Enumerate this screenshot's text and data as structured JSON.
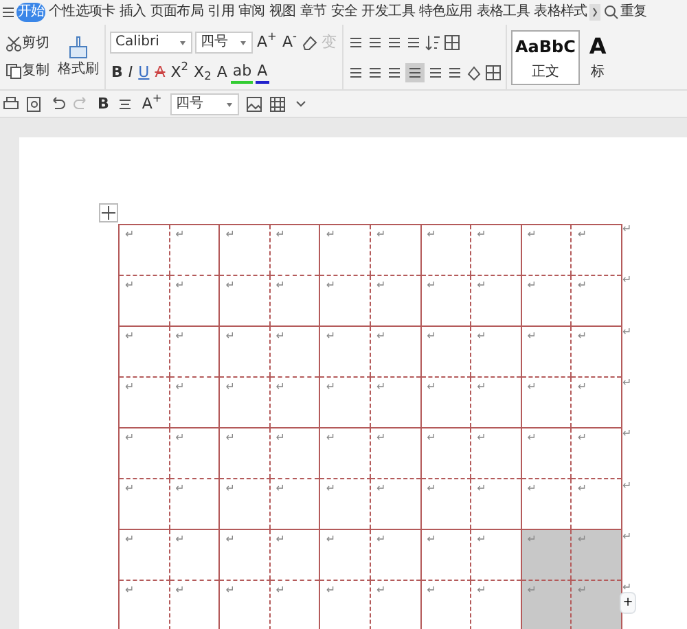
{
  "menu_tabs": [
    {
      "label": "开始",
      "selected": true
    },
    {
      "label": "个性选项卡",
      "selected": false
    },
    {
      "label": "插入",
      "selected": false
    },
    {
      "label": "页面布局",
      "selected": false
    },
    {
      "label": "引用",
      "selected": false
    },
    {
      "label": "审阅",
      "selected": false
    },
    {
      "label": "视图",
      "selected": false
    },
    {
      "label": "章节",
      "selected": false
    },
    {
      "label": "安全",
      "selected": false
    },
    {
      "label": "开发工具",
      "selected": false
    },
    {
      "label": "特色应用",
      "selected": false
    },
    {
      "label": "表格工具",
      "selected": false
    },
    {
      "label": "表格样式",
      "selected": false
    }
  ],
  "search": {
    "label": "重复"
  },
  "clipboard": {
    "cut": "剪切",
    "copy": "复制",
    "format_painter": "格式刷"
  },
  "font": {
    "name": "Calibri",
    "size": "四号"
  },
  "size_buttons": [
    "A$^{+}$",
    "A$^{-}$"
  ],
  "phonetic": {
    "label": "变",
    "disabled": true
  },
  "format_buttons": [
    "B",
    "I",
    "U",
    "A",
    "X$^{2}$",
    "X$_{2}$",
    "A",
    "ab",
    "A"
  ],
  "style_gallery": [
    {
      "sample": "AaBbC",
      "name": "正文",
      "selected": true
    },
    {
      "sample": "A",
      "name": "标",
      "selected": false
    }
  ],
  "quick_toolbar": {
    "bold": "B",
    "grow": "A$^{+}$",
    "size": "四号"
  },
  "table": {
    "rows": [
      {
        "end_mark": "↵",
        "cells": [
          {
            "text": "↵",
            "selected": false
          },
          {
            "text": "↵",
            "selected": false
          },
          {
            "text": "↵",
            "selected": false
          },
          {
            "text": "↵",
            "selected": false
          },
          {
            "text": "↵",
            "selected": false
          },
          {
            "text": "↵",
            "selected": false
          },
          {
            "text": "↵",
            "selected": false
          },
          {
            "text": "↵",
            "selected": false
          },
          {
            "text": "↵",
            "selected": false
          },
          {
            "text": "↵",
            "selected": false
          }
        ]
      },
      {
        "end_mark": "↵",
        "cells": [
          {
            "text": "↵",
            "selected": false
          },
          {
            "text": "↵",
            "selected": false
          },
          {
            "text": "↵",
            "selected": false
          },
          {
            "text": "↵",
            "selected": false
          },
          {
            "text": "↵",
            "selected": false
          },
          {
            "text": "↵",
            "selected": false
          },
          {
            "text": "↵",
            "selected": false
          },
          {
            "text": "↵",
            "selected": false
          },
          {
            "text": "↵",
            "selected": false
          },
          {
            "text": "↵",
            "selected": false
          }
        ]
      },
      {
        "end_mark": "↵",
        "cells": [
          {
            "text": "↵",
            "selected": false
          },
          {
            "text": "↵",
            "selected": false
          },
          {
            "text": "↵",
            "selected": false
          },
          {
            "text": "↵",
            "selected": false
          },
          {
            "text": "↵",
            "selected": false
          },
          {
            "text": "↵",
            "selected": false
          },
          {
            "text": "↵",
            "selected": false
          },
          {
            "text": "↵",
            "selected": false
          },
          {
            "text": "↵",
            "selected": false
          },
          {
            "text": "↵",
            "selected": false
          }
        ]
      },
      {
        "end_mark": "↵",
        "cells": [
          {
            "text": "↵",
            "selected": false
          },
          {
            "text": "↵",
            "selected": false
          },
          {
            "text": "↵",
            "selected": false
          },
          {
            "text": "↵",
            "selected": false
          },
          {
            "text": "↵",
            "selected": false
          },
          {
            "text": "↵",
            "selected": false
          },
          {
            "text": "↵",
            "selected": false
          },
          {
            "text": "↵",
            "selected": false
          },
          {
            "text": "↵",
            "selected": false
          },
          {
            "text": "↵",
            "selected": false
          }
        ]
      },
      {
        "end_mark": "↵",
        "cells": [
          {
            "text": "↵",
            "selected": false
          },
          {
            "text": "↵",
            "selected": false
          },
          {
            "text": "↵",
            "selected": false
          },
          {
            "text": "↵",
            "selected": false
          },
          {
            "text": "↵",
            "selected": false
          },
          {
            "text": "↵",
            "selected": false
          },
          {
            "text": "↵",
            "selected": false
          },
          {
            "text": "↵",
            "selected": false
          },
          {
            "text": "↵",
            "selected": false
          },
          {
            "text": "↵",
            "selected": false
          }
        ]
      },
      {
        "end_mark": "↵",
        "cells": [
          {
            "text": "↵",
            "selected": false
          },
          {
            "text": "↵",
            "selected": false
          },
          {
            "text": "↵",
            "selected": false
          },
          {
            "text": "↵",
            "selected": false
          },
          {
            "text": "↵",
            "selected": false
          },
          {
            "text": "↵",
            "selected": false
          },
          {
            "text": "↵",
            "selected": false
          },
          {
            "text": "↵",
            "selected": false
          },
          {
            "text": "↵",
            "selected": false
          },
          {
            "text": "↵",
            "selected": false
          }
        ]
      },
      {
        "end_mark": "↵",
        "cells": [
          {
            "text": "↵",
            "selected": false
          },
          {
            "text": "↵",
            "selected": false
          },
          {
            "text": "↵",
            "selected": false
          },
          {
            "text": "↵",
            "selected": false
          },
          {
            "text": "↵",
            "selected": false
          },
          {
            "text": "↵",
            "selected": false
          },
          {
            "text": "↵",
            "selected": false
          },
          {
            "text": "↵",
            "selected": false
          },
          {
            "text": "↵",
            "selected": true
          },
          {
            "text": "↵",
            "selected": true
          }
        ]
      },
      {
        "end_mark": "↵",
        "cells": [
          {
            "text": "↵",
            "selected": false
          },
          {
            "text": "↵",
            "selected": false
          },
          {
            "text": "↵",
            "selected": false
          },
          {
            "text": "↵",
            "selected": false
          },
          {
            "text": "↵",
            "selected": false
          },
          {
            "text": "↵",
            "selected": false
          },
          {
            "text": "↵",
            "selected": false
          },
          {
            "text": "↵",
            "selected": false
          },
          {
            "text": "↵",
            "selected": true
          },
          {
            "text": "↵",
            "selected": true
          }
        ]
      }
    ]
  },
  "add_row": "+"
}
